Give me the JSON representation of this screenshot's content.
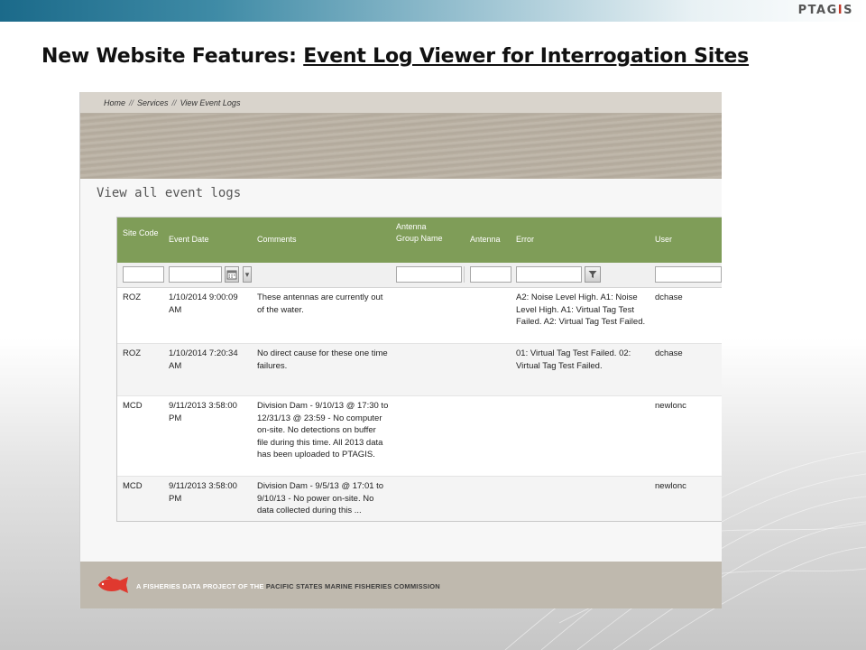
{
  "slide": {
    "logo": {
      "part1": "PTAG",
      "part2": "I",
      "part3": "S"
    },
    "title_prefix": "New Website Features: ",
    "title_underlined": "Event Log Viewer for Interrogation Sites"
  },
  "app": {
    "breadcrumb": [
      "Home",
      "Services",
      "View Event Logs"
    ],
    "breadcrumb_separator": "//",
    "page_heading": "View all event logs",
    "columns": {
      "site_code": "Site Code",
      "event_date": "Event Date",
      "comments": "Comments",
      "antenna_group_name": "Antenna Group Name",
      "antenna": "Antenna",
      "error": "Error",
      "user": "User"
    },
    "rows": [
      {
        "site": "ROZ",
        "date": "1/10/2014 9:00:09 AM",
        "comments": "These antennas are currently out of the water.",
        "antenna_group": "",
        "antenna": "",
        "error": "A2: Noise Level High. A1: Noise Level High. A1: Virtual Tag Test Failed. A2: Virtual Tag Test Failed.",
        "user": "dchase"
      },
      {
        "site": "ROZ",
        "date": "1/10/2014 7:20:34 AM",
        "comments": "No direct cause for these one time failures.",
        "antenna_group": "",
        "antenna": "",
        "error": "01: Virtual Tag Test Failed. 02: Virtual Tag Test Failed.",
        "user": "dchase"
      },
      {
        "site": "MCD",
        "date": "9/11/2013 3:58:00 PM",
        "comments": "Division Dam - 9/10/13 @ 17:30 to 12/31/13 @ 23:59 - No computer on-site. No detections on buffer file during this time. All 2013 data has been uploaded to PTAGIS.",
        "antenna_group": "",
        "antenna": "",
        "error": "",
        "user": "newlonc"
      },
      {
        "site": "MCD",
        "date": "9/11/2013 3:58:00 PM",
        "comments": "Division Dam - 9/5/13 @ 17:01 to 9/10/13 - No power on-site. No data collected during this ...",
        "antenna_group": "",
        "antenna": "",
        "error": "",
        "user": "newlonc"
      }
    ],
    "footer": {
      "prefix": "A FISHERIES DATA PROJECT OF THE",
      "org": "PACIFIC STATES MARINE FISHERIES COMMISSION"
    }
  },
  "icons": [
    "calendar-icon",
    "filter-icon",
    "fish-logo-icon",
    "ptagis-logo"
  ],
  "colors": {
    "grid_header": "#7f9d58",
    "top_band": "#1b6a8a",
    "footer_bg": "#bfb9ae",
    "fish": "#e0392f"
  }
}
